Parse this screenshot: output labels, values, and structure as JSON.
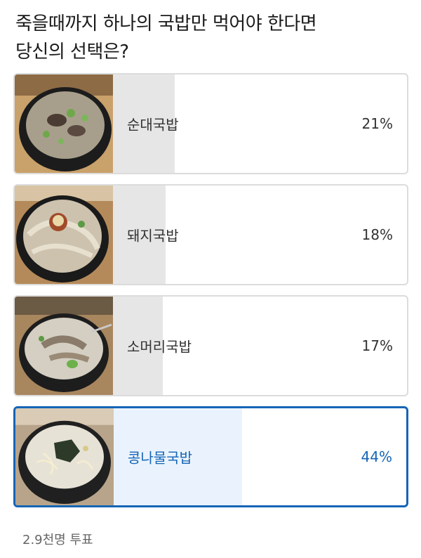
{
  "poll": {
    "question_line1": "죽을때까지 하나의 국밥만 먹어야 한다면",
    "question_line2": "당신의 선택은?",
    "options": [
      {
        "label": "순대국밥",
        "percent_text": "21%",
        "percent": 21,
        "selected": false,
        "image": "sundae-gukbap-photo"
      },
      {
        "label": "돼지국밥",
        "percent_text": "18%",
        "percent": 18,
        "selected": false,
        "image": "dwaeji-gukbap-photo"
      },
      {
        "label": "소머리국밥",
        "percent_text": "17%",
        "percent": 17,
        "selected": false,
        "image": "someori-gukbap-photo"
      },
      {
        "label": "콩나물국밥",
        "percent_text": "44%",
        "percent": 44,
        "selected": true,
        "image": "kongnamul-gukbap-photo"
      }
    ],
    "vote_count": "2.9천명 투표"
  },
  "colors": {
    "accent": "#1565b6",
    "selected_fill": "#eaf3fd",
    "bar_fill": "#e6e6e6",
    "border": "#dcdcdc"
  }
}
